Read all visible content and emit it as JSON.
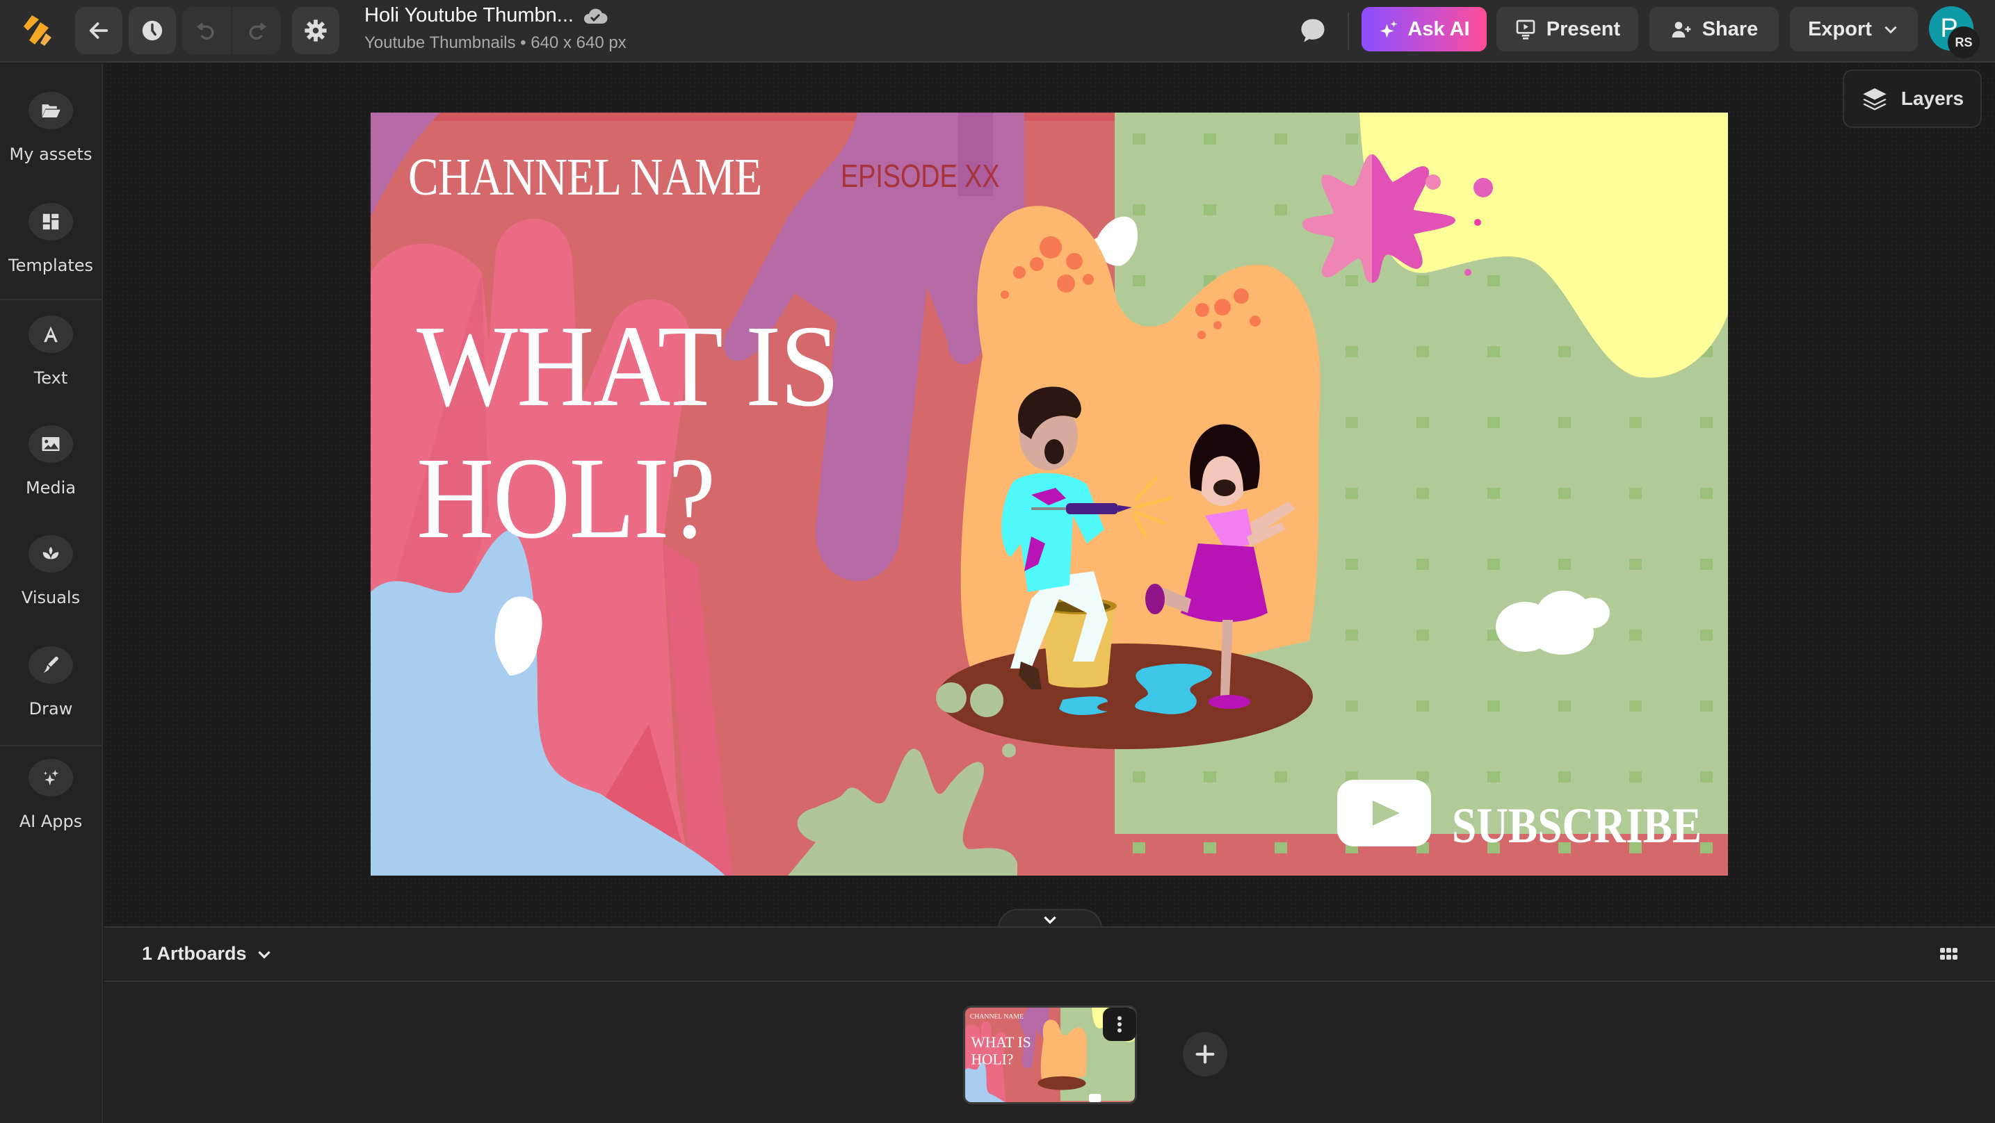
{
  "header": {
    "doc_title": "Holi Youtube Thumbn...",
    "doc_subtitle": "Youtube Thumbnails • 640 x 640 px",
    "back_icon": "arrow-left-icon",
    "history_icon": "clock-icon",
    "undo_icon": "undo-icon",
    "redo_icon": "redo-icon",
    "settings_icon": "gear-icon",
    "save_status_icon": "cloud-check-icon",
    "comment_icon": "comment-icon",
    "ask_ai_label": "Ask AI",
    "present_label": "Present",
    "share_label": "Share",
    "export_label": "Export",
    "avatar_initial": "P",
    "collaborator_initials": "RS"
  },
  "sidebar": {
    "items": [
      {
        "label": "My assets",
        "icon": "folder-icon"
      },
      {
        "label": "Templates",
        "icon": "templates-icon"
      },
      {
        "label": "Text",
        "icon": "text-icon"
      },
      {
        "label": "Media",
        "icon": "image-icon"
      },
      {
        "label": "Visuals",
        "icon": "lotus-icon"
      },
      {
        "label": "Draw",
        "icon": "pen-nib-icon"
      },
      {
        "label": "AI Apps",
        "icon": "sparkles-icon"
      }
    ]
  },
  "workspace": {
    "layers_label": "Layers"
  },
  "canvas": {
    "channel_name": "CHANNEL NAME",
    "episode": "EPISODE XX",
    "title_line1": "WHAT IS",
    "title_line2": "HOLI?",
    "subscribe": "SUBSCRIBE",
    "colors": {
      "coral": "#d4686a",
      "pink": "#eb6b84",
      "purple": "#b56aa5",
      "green": "#b0cb98",
      "green_dot": "#9bc07a",
      "yellow": "#ffff99",
      "blue": "#a8cdef",
      "orange_blob": "#fdb76e"
    }
  },
  "bottom_panel": {
    "artboards_label": "1 Artboards",
    "grid_icon": "grid-icon",
    "add_icon": "plus-icon",
    "thumb_menu_icon": "more-vertical-icon"
  }
}
